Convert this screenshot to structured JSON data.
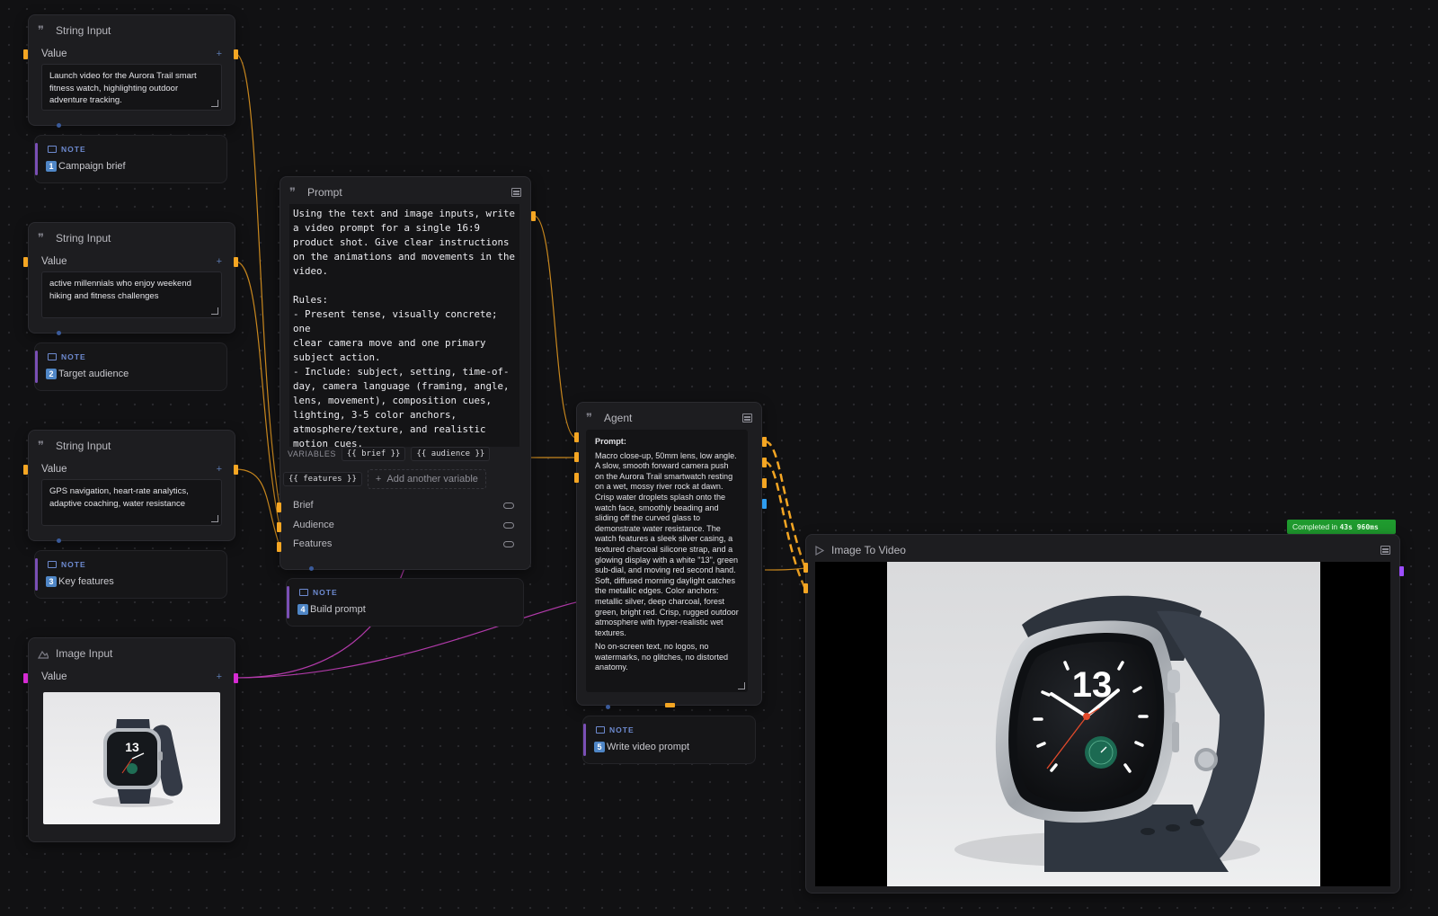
{
  "string_inputs": [
    {
      "title": "String Input",
      "value_label": "Value",
      "value": "Launch video for the Aurora Trail smart fitness watch, highlighting outdoor adventure tracking."
    },
    {
      "title": "String Input",
      "value_label": "Value",
      "value": "active millennials who enjoy weekend hiking and fitness challenges"
    },
    {
      "title": "String Input",
      "value_label": "Value",
      "value": "GPS navigation, heart-rate analytics, adaptive coaching, water resistance"
    }
  ],
  "notes": [
    {
      "label": "NOTE",
      "num": "1",
      "text": "Campaign brief"
    },
    {
      "label": "NOTE",
      "num": "2",
      "text": "Target audience"
    },
    {
      "label": "NOTE",
      "num": "3",
      "text": "Key features"
    },
    {
      "label": "NOTE",
      "num": "4",
      "text": "Build prompt"
    },
    {
      "label": "NOTE",
      "num": "5",
      "text": "Write video prompt"
    }
  ],
  "image_input": {
    "title": "Image Input",
    "value_label": "Value"
  },
  "prompt_node": {
    "title": "Prompt",
    "text": "Using the text and image inputs, write\na video prompt for a single 16:9\nproduct shot. Give clear instructions\non the animations and movements in the\nvideo.\n\nRules:\n- Present tense, visually concrete; one\nclear camera move and one primary\nsubject action.\n- Include: subject, setting, time-of-\nday, camera language (framing, angle,\nlens, movement), composition cues,\nlighting, 3-5 color anchors,\natmosphere/texture, and realistic\nmotion cues.\n- Emphasize the product and key",
    "variables_label": "VARIABLES",
    "variables": [
      "{{ brief }}",
      "{{ audience }}",
      "{{ features }}"
    ],
    "add_variable": "Add another variable",
    "inputs": [
      "Brief",
      "Audience",
      "Features"
    ]
  },
  "agent_node": {
    "title": "Agent",
    "prompt_label": "Prompt:",
    "prompt_text": "Macro close-up, 50mm lens, low angle. A slow, smooth forward camera push on the Aurora Trail smartwatch resting on a wet, mossy river rock at dawn. Crisp water droplets splash onto the watch face, smoothly beading and sliding off the curved glass to demonstrate water resistance. The watch features a sleek silver casing, a textured charcoal silicone strap, and a glowing display with a white \"13\", green sub-dial, and moving red second hand. Soft, diffused morning daylight catches the metallic edges. Color anchors: metallic silver, deep charcoal, forest green, bright red. Crisp, rugged outdoor atmosphere with hyper-realistic wet textures.",
    "negative_text": "No on-screen text, no logos, no watermarks, no glitches, no distorted anatomy."
  },
  "image_to_video": {
    "title": "Image To Video",
    "status_prefix": "Completed in",
    "status_time": "43s 960ms"
  },
  "watch": {
    "number": "13"
  },
  "colors": {
    "port_string": "#f5a623",
    "port_image": "#d62bd3",
    "port_blue": "#2e9df0",
    "port_video": "#9c4dff",
    "status_green": "#1f9a2e",
    "note_accent": "#7a4fb5"
  }
}
